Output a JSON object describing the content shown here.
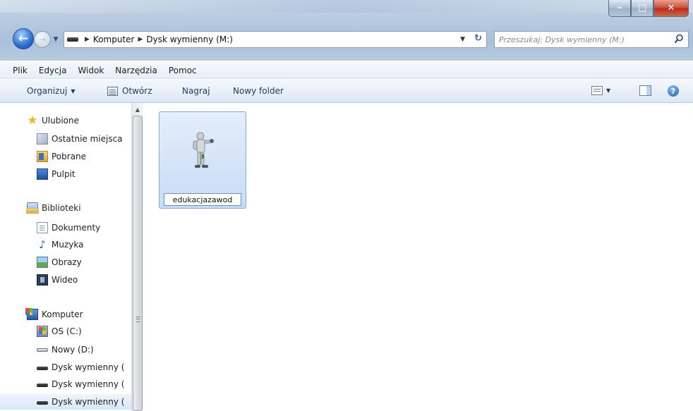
{
  "address": {
    "crumbs": [
      "Komputer",
      "Dysk wymienny (M:)"
    ]
  },
  "search": {
    "placeholder": "Przeszukaj: Dysk wymienny (M:)"
  },
  "menu": [
    "Plik",
    "Edycja",
    "Widok",
    "Narzędzia",
    "Pomoc"
  ],
  "toolbar": {
    "organize": "Organizuj",
    "open": "Otwórz",
    "burn": "Nagraj",
    "new_folder": "Nowy folder",
    "help": "?"
  },
  "nav": {
    "favorites": {
      "label": "Ulubione",
      "items": [
        "Ostatnie miejsca",
        "Pobrane",
        "Pulpit"
      ]
    },
    "libraries": {
      "label": "Biblioteki",
      "items": [
        "Dokumenty",
        "Muzyka",
        "Obrazy",
        "Wideo"
      ]
    },
    "computer": {
      "label": "Komputer",
      "items": [
        "OS (C:)",
        "Nowy (D:)",
        "Dysk wymienny (",
        "Dysk wymienny (",
        "Dysk wymienny ("
      ]
    }
  },
  "files": [
    {
      "name": "edukacjazawod",
      "icon": "robot-figure-icon"
    }
  ],
  "colors": {
    "selection": "#cfe2f8",
    "selection_border": "#84acdd",
    "accent": "#1e3a5f"
  }
}
